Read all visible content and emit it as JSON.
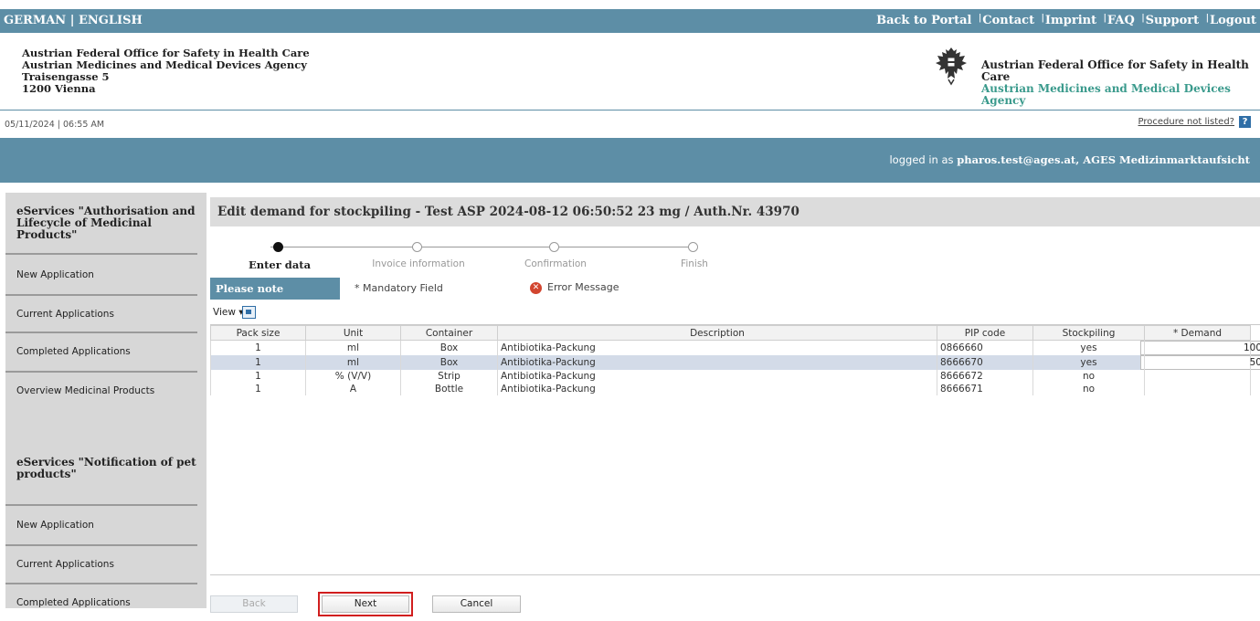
{
  "topbar": {
    "lang": "GERMAN | ENGLISH",
    "links": [
      "Back to Portal",
      "Contact",
      "Imprint",
      "FAQ",
      "Support",
      "Logout"
    ]
  },
  "header": {
    "address": [
      "Austrian Federal Office for Safety in Health Care",
      "Austrian Medicines and Medical Devices Agency",
      "Traisengasse 5",
      "1200 Vienna"
    ],
    "agency_line1": "Austrian Federal Office for Safety in Health Care",
    "agency_line2": "Austrian Medicines and Medical Devices Agency",
    "agency_color": "#3a9a8c"
  },
  "date_row": {
    "datetime": "05/11/2024 | 06:55 AM",
    "procedure_link": "Procedure not listed?",
    "help_icon": "?"
  },
  "banner": {
    "logged_prefix": "logged in as",
    "user": "pharos.test@ages.at, AGES Medizinmarktaufsicht"
  },
  "sidebar": {
    "group1_title": "eServices \"Authorisation and Lifecycle of Medicinal Products\"",
    "group1_items": [
      "New Application",
      "Current Applications",
      "Completed Applications",
      "Overview Medicinal Products"
    ],
    "group2_title": "eServices \"Notification of pet products\"",
    "group2_items": [
      "New Application",
      "Current Applications",
      "Completed Applications"
    ]
  },
  "main": {
    "title": "Edit demand for stockpiling - Test ASP 2024-08-12 06:50:52 23 mg / Auth.Nr. 43970",
    "steps": [
      "Enter data",
      "Invoice information",
      "Confirmation",
      "Finish"
    ],
    "active_step": 0,
    "please_note": "Please note",
    "mandatory": "* Mandatory Field",
    "error_message": "Error Message",
    "view_label": "View ▾"
  },
  "table": {
    "columns": [
      "Pack size",
      "Unit",
      "Container",
      "Description",
      "PIP code",
      "Stockpiling",
      "* Demand"
    ],
    "rows": [
      {
        "pack": "1",
        "unit": "ml",
        "container": "Box",
        "desc": "Antibiotika-Packung",
        "pip": "0866660",
        "stock": "yes",
        "demand": "100"
      },
      {
        "pack": "1",
        "unit": "ml",
        "container": "Box",
        "desc": "Antibiotika-Packung",
        "pip": "8666670",
        "stock": "yes",
        "demand": "50"
      },
      {
        "pack": "1",
        "unit": "% (V/V)",
        "container": "Strip",
        "desc": "Antibiotika-Packung",
        "pip": "8666672",
        "stock": "no",
        "demand": ""
      },
      {
        "pack": "1",
        "unit": "A",
        "container": "Bottle",
        "desc": "Antibiotika-Packung",
        "pip": "8666671",
        "stock": "no",
        "demand": ""
      }
    ]
  },
  "buttons": {
    "back": "Back",
    "next": "Next",
    "cancel": "Cancel"
  },
  "colors": {
    "brand": "#5d8ea6",
    "selected_row": "#d3dbe8",
    "highlight": "#d11e1e"
  }
}
